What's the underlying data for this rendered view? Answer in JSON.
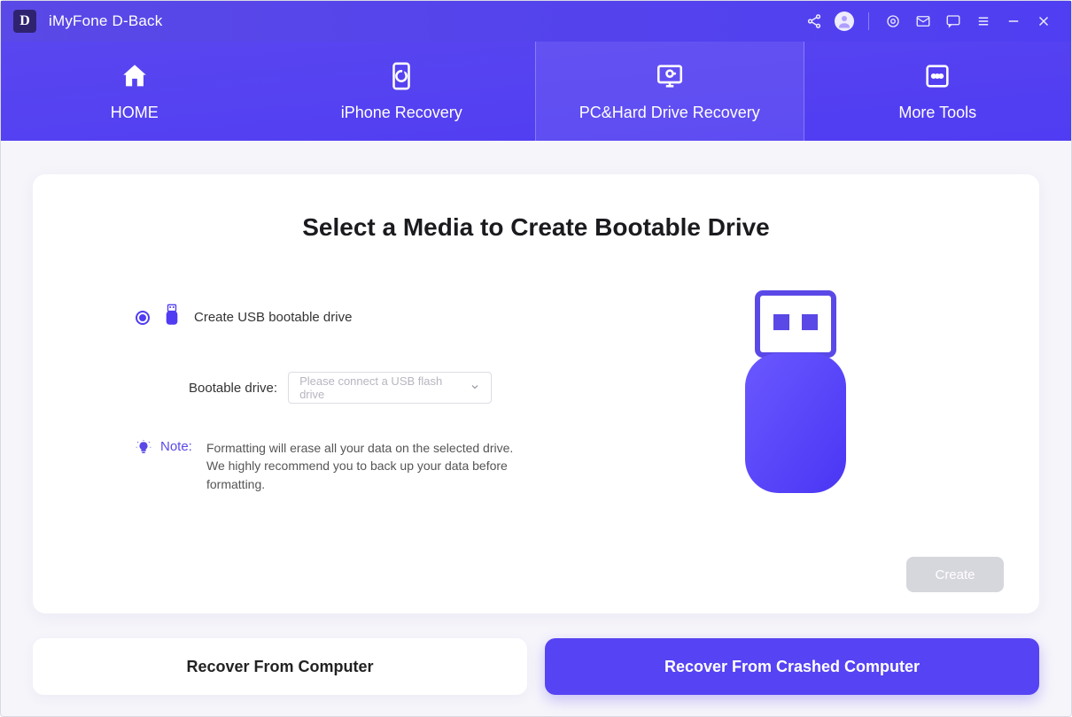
{
  "titlebar": {
    "app_name": "iMyFone D-Back",
    "logo_letter": "D"
  },
  "nav": {
    "tabs": [
      {
        "label": "HOME",
        "icon": "home-icon"
      },
      {
        "label": "iPhone Recovery",
        "icon": "iphone-recovery-icon"
      },
      {
        "label": "PC&Hard Drive Recovery",
        "icon": "pc-recovery-icon"
      },
      {
        "label": "More Tools",
        "icon": "more-tools-icon"
      }
    ],
    "active_index": 2
  },
  "main": {
    "title": "Select a Media to Create Bootable Drive",
    "option_label": "Create USB bootable drive",
    "bootable_drive_label": "Bootable drive:",
    "bootable_drive_placeholder": "Please connect a USB flash drive",
    "note_label": "Note:",
    "note_text": "Formatting will erase all your data on the selected drive. We highly recommend you to back up your data before formatting.",
    "create_button": "Create"
  },
  "bottom": {
    "tabs": [
      {
        "label": "Recover From Computer"
      },
      {
        "label": "Recover From Crashed Computer"
      }
    ],
    "active_index": 1
  },
  "colors": {
    "accent": "#5643f3"
  }
}
